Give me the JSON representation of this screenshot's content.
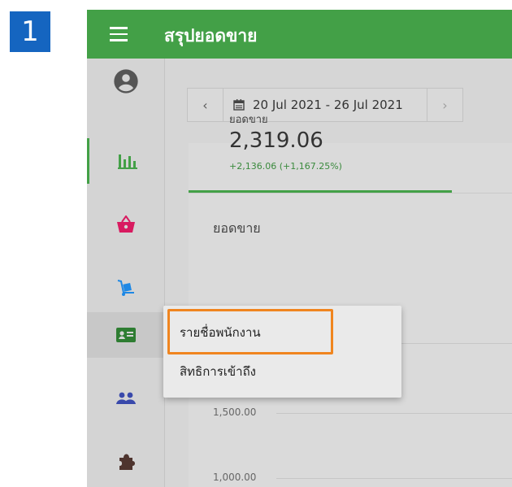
{
  "step": {
    "number": "1"
  },
  "topbar": {
    "title": "สรุปยอดขาย"
  },
  "sidebar": {
    "items": [
      {
        "icon": "account-circle-icon",
        "color": "#555555"
      },
      {
        "icon": "bar-chart-icon",
        "color": "#43a047",
        "active": true
      },
      {
        "icon": "basket-icon",
        "color": "#d81b60"
      },
      {
        "icon": "hand-truck-icon",
        "color": "#1e88e5"
      },
      {
        "icon": "id-card-icon",
        "color": "#2e7d32",
        "hovered": true
      },
      {
        "icon": "people-icon",
        "color": "#3949ab"
      },
      {
        "icon": "puzzle-icon",
        "color": "#4e342e"
      }
    ]
  },
  "date_range": {
    "label": "20 Jul 2021 - 26 Jul 2021",
    "prev": "‹",
    "next": "›"
  },
  "kpi": {
    "label": "ยอดขาย",
    "value": "2,319.06",
    "change": "+2,136.06 (+1,167.25%)"
  },
  "chart": {
    "title": "ยอดขาย",
    "y_ticks": [
      "1,500.00",
      "1,000.00"
    ]
  },
  "menu": {
    "items": [
      {
        "label": "รายชื่อพนักงาน",
        "highlighted": true
      },
      {
        "label": "สิทธิการเข้าถึง"
      }
    ]
  },
  "colors": {
    "accent": "#43a047",
    "highlight": "#f0851f",
    "badge": "#1565c0"
  }
}
